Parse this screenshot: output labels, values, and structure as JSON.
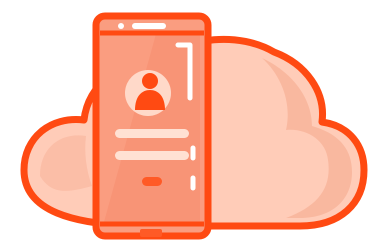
{
  "illustration": {
    "subject": "phone-with-user-profile-over-cloud",
    "icons": [
      "cloud-icon",
      "smartphone-icon",
      "user-avatar-icon"
    ],
    "colors": {
      "outline": "#ff4a12",
      "cloud_fill": "#ffccb8",
      "cloud_shade": "#f9b89f",
      "phone_body": "#fa9d80",
      "phone_shade": "#f68c6d",
      "avatar_ring": "#ffd9c9",
      "avatar_figure": "#ff4a12",
      "text_lines": "#ffe1d3",
      "highlight": "#ffffff",
      "accent_pill": "#ff5a26"
    }
  }
}
